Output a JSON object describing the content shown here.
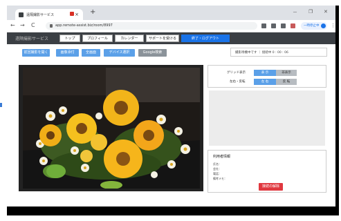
{
  "browser": {
    "tab_title": "遠隔撮影サービス",
    "tab_close": "×",
    "new_tab": "+",
    "win_min": "－",
    "win_max": "❐",
    "win_close": "✕",
    "nav_back": "←",
    "nav_forward": "→",
    "nav_reload": "C",
    "url": "app.remote-assist.biz/room/8997",
    "profile_label": "一時停止中"
  },
  "app": {
    "brand": "遠隔撮影サービス",
    "nav": [
      {
        "label": "トップ"
      },
      {
        "label": "プロフィール"
      },
      {
        "label": "カレンダー"
      },
      {
        "label": "サポートを受ける"
      },
      {
        "label": "終了・ログアウト"
      }
    ]
  },
  "actions": [
    {
      "label": "前回撮影を開く"
    },
    {
      "label": "画像添付"
    },
    {
      "label": "全画面"
    },
    {
      "label": "デバイス選択"
    },
    {
      "label": "Google検索"
    }
  ],
  "status_text": "撮影待機中です ｜ 接続中 0 : 00 : 06",
  "controls": {
    "grid_label": "グリッド表示",
    "grid_on": "表 示",
    "grid_off": "非表示",
    "mirror_label": "左右・反転",
    "mirror_on": "左 右",
    "mirror_off": "反 転"
  },
  "info": {
    "title": "利用者情報",
    "rows": [
      "氏名：",
      "会社：",
      "電話：",
      "備考メモ："
    ],
    "button": "接続の解除"
  },
  "colors": {
    "accent_blue": "#1a73e8",
    "button_blue": "#5ba0e8",
    "danger_red": "#e0383f",
    "nav_dark": "#3b3f44"
  }
}
